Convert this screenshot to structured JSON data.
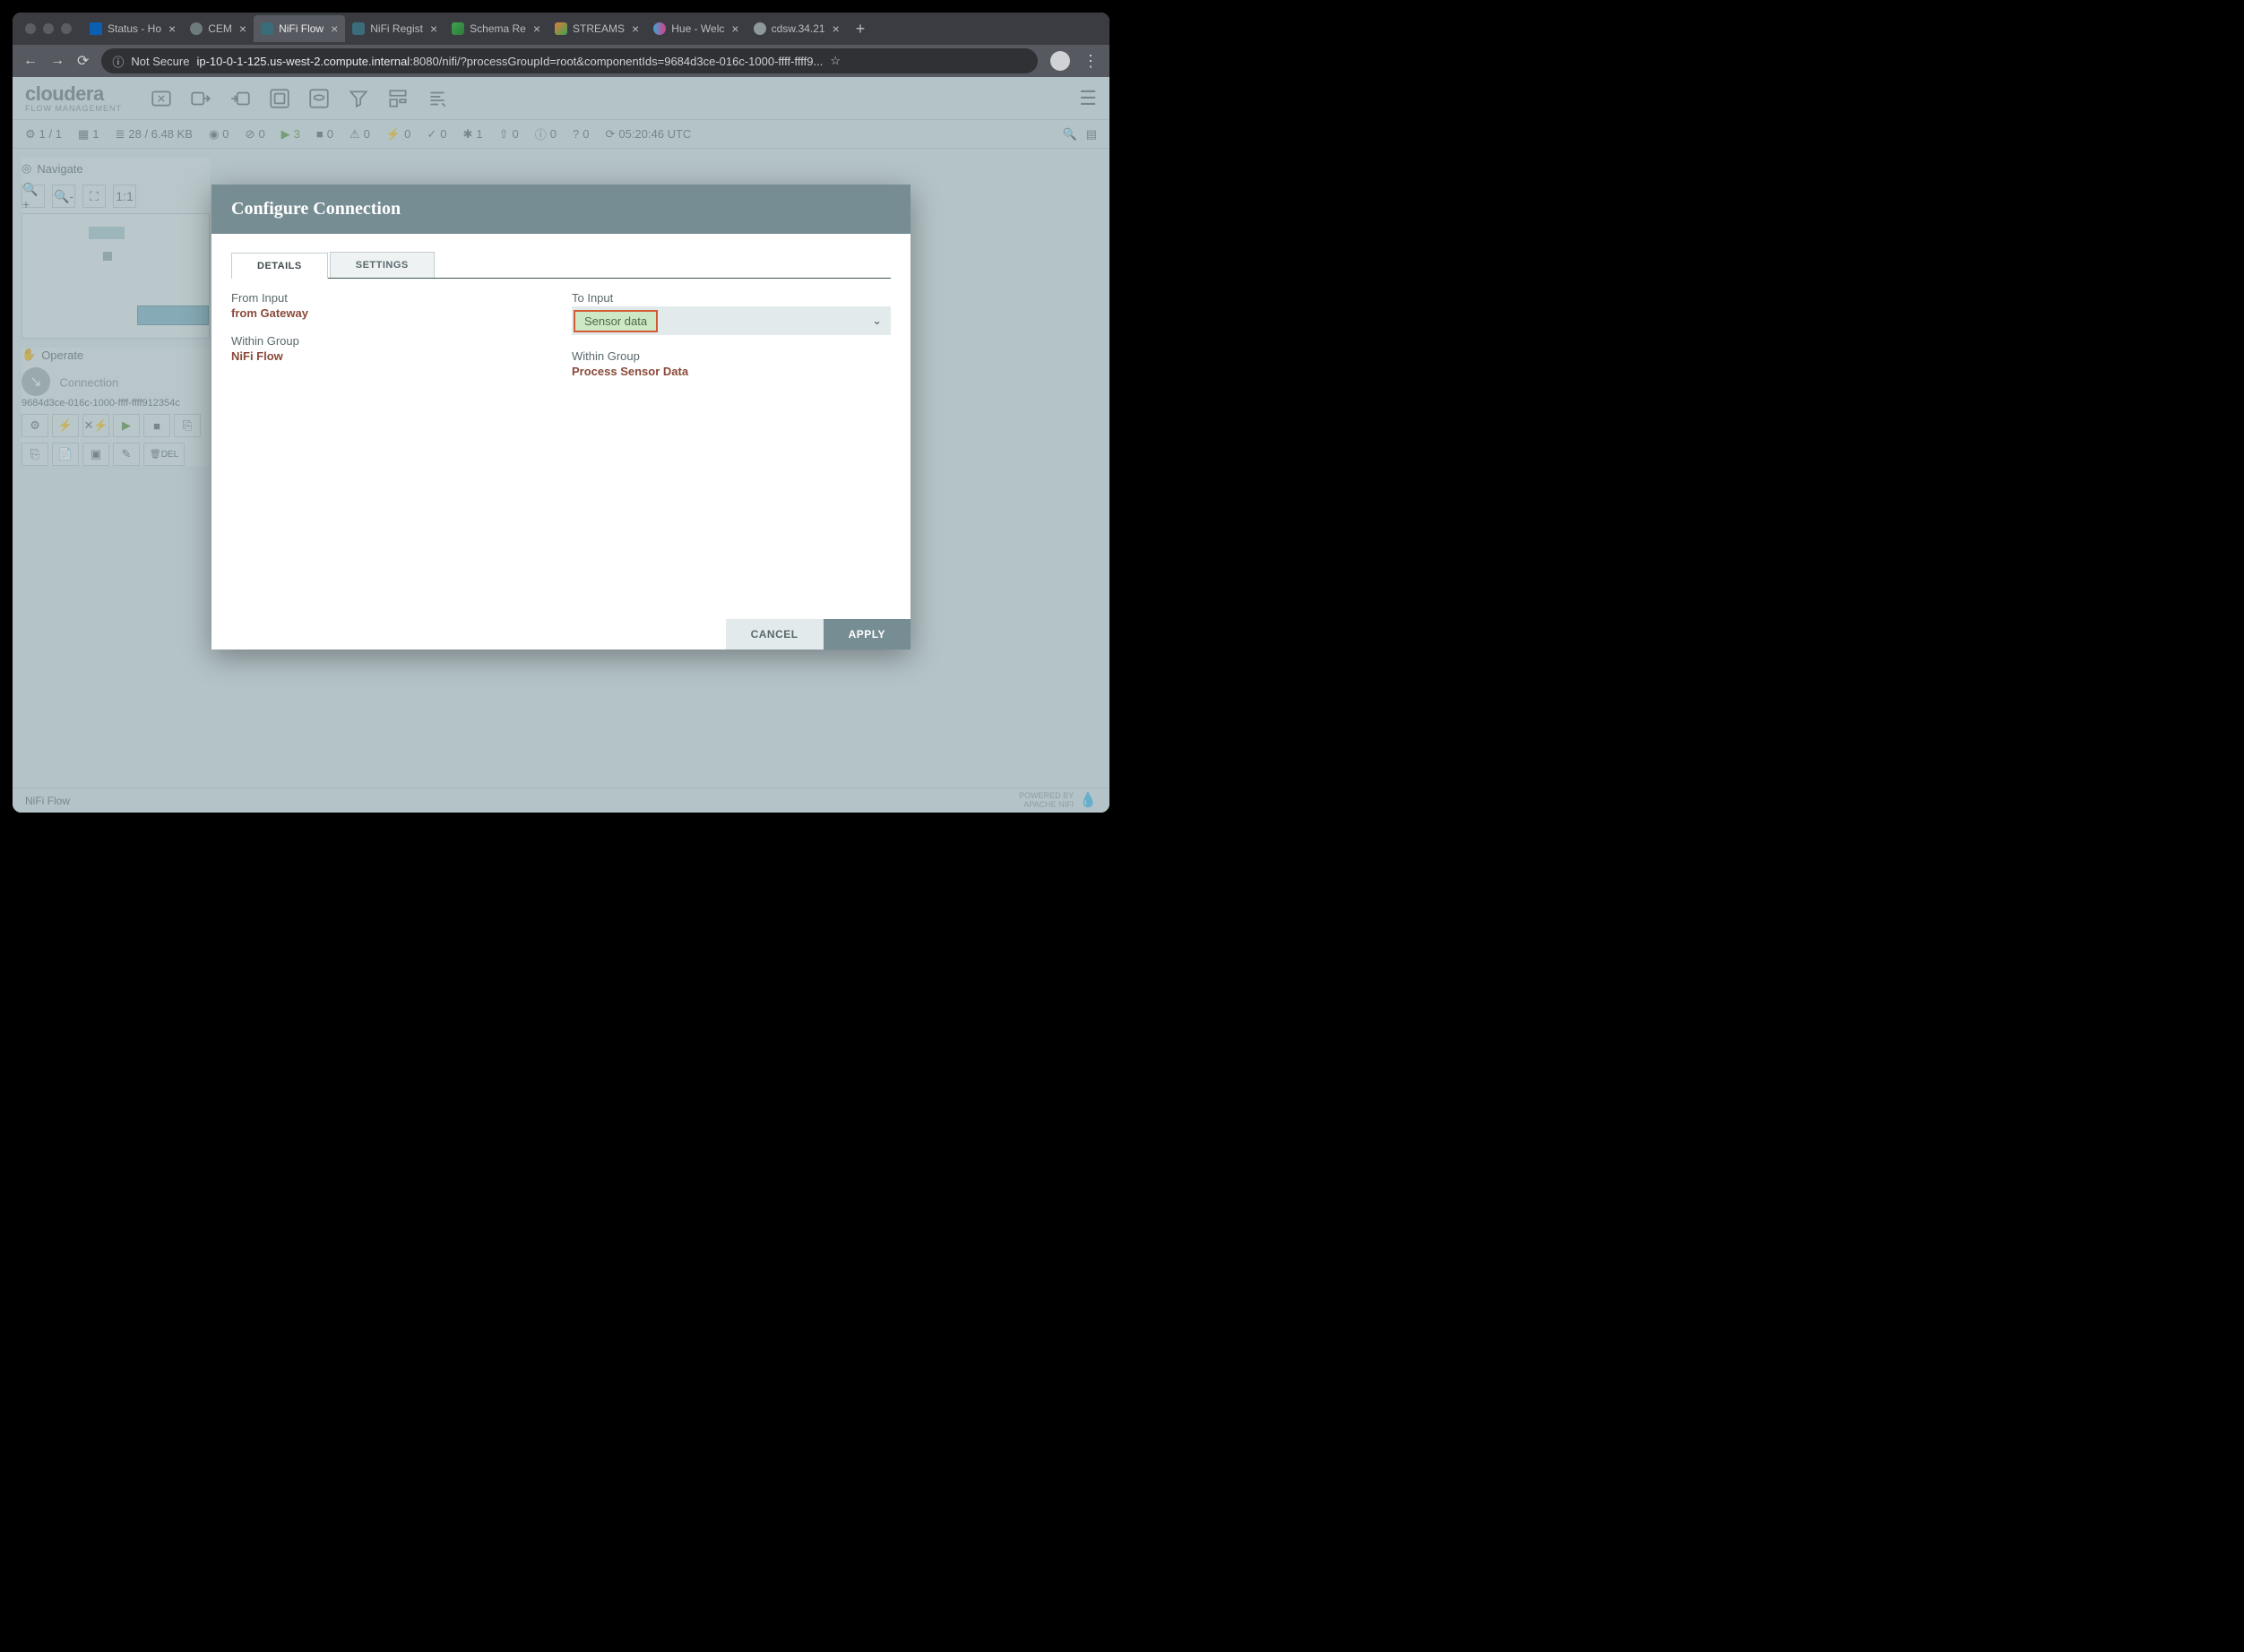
{
  "browser": {
    "tabs": [
      {
        "label": "Status - Ho",
        "active": false
      },
      {
        "label": "CEM",
        "active": false
      },
      {
        "label": "NiFi Flow",
        "active": true
      },
      {
        "label": "NiFi Regist",
        "active": false
      },
      {
        "label": "Schema Re",
        "active": false
      },
      {
        "label": "STREAMS",
        "active": false
      },
      {
        "label": "Hue - Welc",
        "active": false
      },
      {
        "label": "cdsw.34.21",
        "active": false
      }
    ],
    "security_label": "Not Secure",
    "url_host": "ip-10-0-1-125.us-west-2.compute.internal",
    "url_rest": ":8080/nifi/?processGroupId=root&componentIds=9684d3ce-016c-1000-ffff-ffff9..."
  },
  "logo": {
    "brand": "cloudera",
    "sub": "FLOW MANAGEMENT"
  },
  "status": {
    "threads": "1 / 1",
    "groups": "1",
    "queue": "28 / 6.48 KB",
    "transmitting": "0",
    "not_transmitting": "0",
    "running": "3",
    "stopped": "0",
    "invalid": "0",
    "disabled": "0",
    "up_to_date": "0",
    "locally_modified": "1",
    "stale": "0",
    "sync_failure": "0",
    "unknown": "0",
    "refresh_time": "05:20:46 UTC"
  },
  "sidebar": {
    "navigate_label": "Navigate",
    "operate_label": "Operate",
    "connection_label": "Connection",
    "uuid": "9684d3ce-016c-1000-ffff-ffff912354c",
    "delete_label": "DEL"
  },
  "footer": {
    "breadcrumb": "NiFi Flow",
    "powered": "POWERED BY",
    "powered2": "APACHE NIFI"
  },
  "dialog": {
    "title": "Configure Connection",
    "tabs": {
      "details": "DETAILS",
      "settings": "SETTINGS"
    },
    "from_label": "From Input",
    "from_value": "from Gateway",
    "from_group_label": "Within Group",
    "from_group_value": "NiFi Flow",
    "to_label": "To Input",
    "to_value": "Sensor data",
    "to_group_label": "Within Group",
    "to_group_value": "Process Sensor Data",
    "cancel": "CANCEL",
    "apply": "APPLY"
  }
}
